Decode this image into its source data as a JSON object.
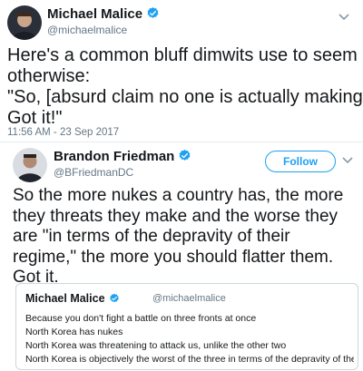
{
  "tweet": {
    "author_name": "Michael Malice",
    "author_handle": "@michaelmalice",
    "body_lines": [
      "Here's a common bluff dimwits use to seem",
      "otherwise:",
      "\"So, [absurd claim no one is actually making.]",
      "Got it!\""
    ],
    "timestamp": "11:56 AM - 23 Sep 2017",
    "icons": {
      "avatar": "avatar-icon",
      "verified": "verified-badge-icon",
      "menu": "chevron-down-icon"
    }
  },
  "reply": {
    "author_name": "Brandon Friedman",
    "author_handle": "@BFriedmanDC",
    "follow_label": "Follow",
    "body_lines": [
      "So the more nukes a country has, the more",
      "they threats they make and the worse they",
      "are \"in terms of the depravity of their",
      "regime,\" the more you should flatter them.",
      "Got it."
    ],
    "icons": {
      "avatar": "avatar-icon",
      "verified": "verified-badge-icon",
      "menu": "chevron-down-icon"
    }
  },
  "quoted": {
    "author_name": "Michael Malice",
    "author_handle": "@michaelmalice",
    "lines": [
      "Because you don't fight a battle on three fronts at once",
      "North Korea has nukes",
      "North Korea was threatening to attack us, unlike the other two",
      "North Korea is objectively the worst of the three in terms of the depravity of their..."
    ]
  },
  "colors": {
    "verified_blue": "#1da1f2",
    "text": "#14171a",
    "muted": "#657786",
    "border": "#ccd6dd"
  }
}
